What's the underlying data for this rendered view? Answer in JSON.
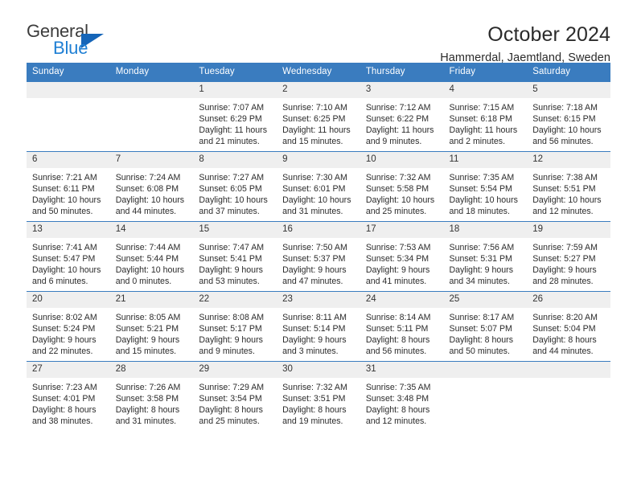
{
  "brand": {
    "name_top": "General",
    "name_bottom": "Blue",
    "triangle_color": "#1565b8",
    "blue_color": "#1e7fd4"
  },
  "header": {
    "title": "October 2024",
    "location": "Hammerdal, Jaemtland, Sweden"
  },
  "theme": {
    "header_blue": "#3a7cbf",
    "daynum_band": "#efefef"
  },
  "weekday_headers": [
    "Sunday",
    "Monday",
    "Tuesday",
    "Wednesday",
    "Thursday",
    "Friday",
    "Saturday"
  ],
  "weeks": [
    [
      {
        "day": "",
        "sunrise": "",
        "sunset": "",
        "daylight_1": "",
        "daylight_2": ""
      },
      {
        "day": "",
        "sunrise": "",
        "sunset": "",
        "daylight_1": "",
        "daylight_2": ""
      },
      {
        "day": "1",
        "sunrise": "Sunrise: 7:07 AM",
        "sunset": "Sunset: 6:29 PM",
        "daylight_1": "Daylight: 11 hours",
        "daylight_2": "and 21 minutes."
      },
      {
        "day": "2",
        "sunrise": "Sunrise: 7:10 AM",
        "sunset": "Sunset: 6:25 PM",
        "daylight_1": "Daylight: 11 hours",
        "daylight_2": "and 15 minutes."
      },
      {
        "day": "3",
        "sunrise": "Sunrise: 7:12 AM",
        "sunset": "Sunset: 6:22 PM",
        "daylight_1": "Daylight: 11 hours",
        "daylight_2": "and 9 minutes."
      },
      {
        "day": "4",
        "sunrise": "Sunrise: 7:15 AM",
        "sunset": "Sunset: 6:18 PM",
        "daylight_1": "Daylight: 11 hours",
        "daylight_2": "and 2 minutes."
      },
      {
        "day": "5",
        "sunrise": "Sunrise: 7:18 AM",
        "sunset": "Sunset: 6:15 PM",
        "daylight_1": "Daylight: 10 hours",
        "daylight_2": "and 56 minutes."
      }
    ],
    [
      {
        "day": "6",
        "sunrise": "Sunrise: 7:21 AM",
        "sunset": "Sunset: 6:11 PM",
        "daylight_1": "Daylight: 10 hours",
        "daylight_2": "and 50 minutes."
      },
      {
        "day": "7",
        "sunrise": "Sunrise: 7:24 AM",
        "sunset": "Sunset: 6:08 PM",
        "daylight_1": "Daylight: 10 hours",
        "daylight_2": "and 44 minutes."
      },
      {
        "day": "8",
        "sunrise": "Sunrise: 7:27 AM",
        "sunset": "Sunset: 6:05 PM",
        "daylight_1": "Daylight: 10 hours",
        "daylight_2": "and 37 minutes."
      },
      {
        "day": "9",
        "sunrise": "Sunrise: 7:30 AM",
        "sunset": "Sunset: 6:01 PM",
        "daylight_1": "Daylight: 10 hours",
        "daylight_2": "and 31 minutes."
      },
      {
        "day": "10",
        "sunrise": "Sunrise: 7:32 AM",
        "sunset": "Sunset: 5:58 PM",
        "daylight_1": "Daylight: 10 hours",
        "daylight_2": "and 25 minutes."
      },
      {
        "day": "11",
        "sunrise": "Sunrise: 7:35 AM",
        "sunset": "Sunset: 5:54 PM",
        "daylight_1": "Daylight: 10 hours",
        "daylight_2": "and 18 minutes."
      },
      {
        "day": "12",
        "sunrise": "Sunrise: 7:38 AM",
        "sunset": "Sunset: 5:51 PM",
        "daylight_1": "Daylight: 10 hours",
        "daylight_2": "and 12 minutes."
      }
    ],
    [
      {
        "day": "13",
        "sunrise": "Sunrise: 7:41 AM",
        "sunset": "Sunset: 5:47 PM",
        "daylight_1": "Daylight: 10 hours",
        "daylight_2": "and 6 minutes."
      },
      {
        "day": "14",
        "sunrise": "Sunrise: 7:44 AM",
        "sunset": "Sunset: 5:44 PM",
        "daylight_1": "Daylight: 10 hours",
        "daylight_2": "and 0 minutes."
      },
      {
        "day": "15",
        "sunrise": "Sunrise: 7:47 AM",
        "sunset": "Sunset: 5:41 PM",
        "daylight_1": "Daylight: 9 hours",
        "daylight_2": "and 53 minutes."
      },
      {
        "day": "16",
        "sunrise": "Sunrise: 7:50 AM",
        "sunset": "Sunset: 5:37 PM",
        "daylight_1": "Daylight: 9 hours",
        "daylight_2": "and 47 minutes."
      },
      {
        "day": "17",
        "sunrise": "Sunrise: 7:53 AM",
        "sunset": "Sunset: 5:34 PM",
        "daylight_1": "Daylight: 9 hours",
        "daylight_2": "and 41 minutes."
      },
      {
        "day": "18",
        "sunrise": "Sunrise: 7:56 AM",
        "sunset": "Sunset: 5:31 PM",
        "daylight_1": "Daylight: 9 hours",
        "daylight_2": "and 34 minutes."
      },
      {
        "day": "19",
        "sunrise": "Sunrise: 7:59 AM",
        "sunset": "Sunset: 5:27 PM",
        "daylight_1": "Daylight: 9 hours",
        "daylight_2": "and 28 minutes."
      }
    ],
    [
      {
        "day": "20",
        "sunrise": "Sunrise: 8:02 AM",
        "sunset": "Sunset: 5:24 PM",
        "daylight_1": "Daylight: 9 hours",
        "daylight_2": "and 22 minutes."
      },
      {
        "day": "21",
        "sunrise": "Sunrise: 8:05 AM",
        "sunset": "Sunset: 5:21 PM",
        "daylight_1": "Daylight: 9 hours",
        "daylight_2": "and 15 minutes."
      },
      {
        "day": "22",
        "sunrise": "Sunrise: 8:08 AM",
        "sunset": "Sunset: 5:17 PM",
        "daylight_1": "Daylight: 9 hours",
        "daylight_2": "and 9 minutes."
      },
      {
        "day": "23",
        "sunrise": "Sunrise: 8:11 AM",
        "sunset": "Sunset: 5:14 PM",
        "daylight_1": "Daylight: 9 hours",
        "daylight_2": "and 3 minutes."
      },
      {
        "day": "24",
        "sunrise": "Sunrise: 8:14 AM",
        "sunset": "Sunset: 5:11 PM",
        "daylight_1": "Daylight: 8 hours",
        "daylight_2": "and 56 minutes."
      },
      {
        "day": "25",
        "sunrise": "Sunrise: 8:17 AM",
        "sunset": "Sunset: 5:07 PM",
        "daylight_1": "Daylight: 8 hours",
        "daylight_2": "and 50 minutes."
      },
      {
        "day": "26",
        "sunrise": "Sunrise: 8:20 AM",
        "sunset": "Sunset: 5:04 PM",
        "daylight_1": "Daylight: 8 hours",
        "daylight_2": "and 44 minutes."
      }
    ],
    [
      {
        "day": "27",
        "sunrise": "Sunrise: 7:23 AM",
        "sunset": "Sunset: 4:01 PM",
        "daylight_1": "Daylight: 8 hours",
        "daylight_2": "and 38 minutes."
      },
      {
        "day": "28",
        "sunrise": "Sunrise: 7:26 AM",
        "sunset": "Sunset: 3:58 PM",
        "daylight_1": "Daylight: 8 hours",
        "daylight_2": "and 31 minutes."
      },
      {
        "day": "29",
        "sunrise": "Sunrise: 7:29 AM",
        "sunset": "Sunset: 3:54 PM",
        "daylight_1": "Daylight: 8 hours",
        "daylight_2": "and 25 minutes."
      },
      {
        "day": "30",
        "sunrise": "Sunrise: 7:32 AM",
        "sunset": "Sunset: 3:51 PM",
        "daylight_1": "Daylight: 8 hours",
        "daylight_2": "and 19 minutes."
      },
      {
        "day": "31",
        "sunrise": "Sunrise: 7:35 AM",
        "sunset": "Sunset: 3:48 PM",
        "daylight_1": "Daylight: 8 hours",
        "daylight_2": "and 12 minutes."
      },
      {
        "day": "",
        "sunrise": "",
        "sunset": "",
        "daylight_1": "",
        "daylight_2": ""
      },
      {
        "day": "",
        "sunrise": "",
        "sunset": "",
        "daylight_1": "",
        "daylight_2": ""
      }
    ]
  ]
}
